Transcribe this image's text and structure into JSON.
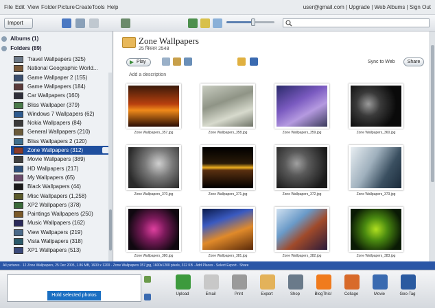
{
  "menu": [
    "File",
    "Edit",
    "View",
    "Folder",
    "Picture",
    "Create",
    "Tools",
    "Help"
  ],
  "account": "user@gmail.com | Upgrade | Web Albums | Sign Out",
  "toolbar": {
    "import_label": "Import"
  },
  "search": {
    "placeholder": ""
  },
  "zoom_slider": {
    "level": 0.55
  },
  "sidebar": {
    "albums": "Albums (1)",
    "folders": "Folders (89)",
    "items": [
      {
        "label": "Travel Wallpapers (325)",
        "color": "#6d7a89"
      },
      {
        "label": "National Geographic World...",
        "color": "#7a5a3a"
      },
      {
        "label": "Game Wallpaper 2 (155)",
        "color": "#3b4f6e"
      },
      {
        "label": "Game Wallpapers (184)",
        "color": "#5a3a3a"
      },
      {
        "label": "Car Wallpapers (160)",
        "color": "#2f2f3a"
      },
      {
        "label": "Bliss Wallpaper (379)",
        "color": "#4a7a4a"
      },
      {
        "label": "Windows 7 Wallpapers (62)",
        "color": "#2e5b8f"
      },
      {
        "label": "Nokia Wallpapers (84)",
        "color": "#3a3a3a"
      },
      {
        "label": "General Wallpapers (210)",
        "color": "#6b5b3a"
      },
      {
        "label": "Bliss Wallpapers 2 (120)",
        "color": "#3f6f8f"
      },
      {
        "label": "Zone Wallpapers (312)",
        "color": "#8a3a2a",
        "selected": true
      },
      {
        "label": "Movie Wallpapers (389)",
        "color": "#404040"
      },
      {
        "label": "HD Wallpapers (217)",
        "color": "#2d4f7a"
      },
      {
        "label": "My Wallpapers (65)",
        "color": "#6a4a6a"
      },
      {
        "label": "Black Wallpapers (44)",
        "color": "#1a1a1a"
      },
      {
        "label": "Misc Wallpapers (1,258)",
        "color": "#5a5a2a"
      },
      {
        "label": "XP2 Wallpapers (378)",
        "color": "#3a6a3a"
      },
      {
        "label": "Paintings Wallpapers (250)",
        "color": "#7a5a2a"
      },
      {
        "label": "Music Wallpapers (162)",
        "color": "#2a2a5a"
      },
      {
        "label": "View Wallpapers (219)",
        "color": "#4a6a8a"
      },
      {
        "label": "Vista Wallpapers (318)",
        "color": "#2a5a6a"
      },
      {
        "label": "XP1 Wallpapers (513)",
        "color": "#3a4a7a"
      }
    ]
  },
  "main": {
    "title": "Zone Wallpapers",
    "date": "25 विस्तार 2548",
    "play_label": "Play",
    "share_label": "Share",
    "sync_label": "Sync to Web",
    "add_description": "Add a description",
    "thumbs": [
      {
        "caption": "Zone Wallpapers_357.jpg",
        "bg": "linear-gradient(180deg,#3a1a0a 0%,#b8400e 45%,#f08a1a 60%,#2a0c04 100%)"
      },
      {
        "caption": "Zone Wallpapers_358.jpg",
        "bg": "linear-gradient(160deg,#c8ccc0 0%,#8f9486 40%,#d7dacd 70%,#6f7468 100%)"
      },
      {
        "caption": "Zone Wallpapers_359.jpg",
        "bg": "linear-gradient(150deg,#2a2a6a 0%,#7a5ac0 40%,#b59ae0 65%,#3a3a5a 100%)"
      },
      {
        "caption": "Zone Wallpapers_360.jpg",
        "bg": "radial-gradient(circle at 35% 45%,#9a9a9a 0%,#3a3a3a 30%,#0a0a0a 70%)"
      },
      {
        "caption": "Zone Wallpapers_370.jpg",
        "bg": "radial-gradient(circle at 60% 40%,#d0d0d0 0%,#7a7a7a 35%,#2a2a2a 80%)"
      },
      {
        "caption": "Zone Wallpapers_371.jpg",
        "bg": "linear-gradient(180deg,#000 0%,#2a1a08 40%,#f0b020 50%,#5a3010 56%,#000 100%)"
      },
      {
        "caption": "Zone Wallpapers_372.jpg",
        "bg": "radial-gradient(circle at 40% 40%,#a0a0a0 0%,#5a5a5a 30%,#1a1a1a 80%)"
      },
      {
        "caption": "Zone Wallpapers_373.jpg",
        "bg": "linear-gradient(120deg,#e8eef2 0%,#9fb0bd 40%,#3a4f60 70%,#1a2a3a 100%)"
      },
      {
        "caption": "Zone Wallpapers_380.jpg",
        "bg": "radial-gradient(circle at 50% 50%,#e040a0 0%,#7a1a5a 35%,#100810 80%)"
      },
      {
        "caption": "Zone Wallpapers_381.jpg",
        "bg": "linear-gradient(160deg,#0a1a4a 0%,#3a5ac0 30%,#e08a2a 60%,#5a2a0a 100%)"
      },
      {
        "caption": "Zone Wallpapers_382.jpg",
        "bg": "linear-gradient(140deg,#cfe0f0 0%,#6a9ac8 35%,#a04a2a 60%,#2a1a3a 100%)"
      },
      {
        "caption": "Zone Wallpapers_383.jpg",
        "bg": "radial-gradient(circle at 50% 50%,#b0e020 0%,#4a8a10 35%,#0a1a05 80%)"
      }
    ]
  },
  "status": "All pictures · 12 Zone Wallpapers, 25 Dec 2005, 1.86 MB, 1600 x 1200 · Zone Wallpapers 357.jpg, 1600x1200 pixels, 312 KB · Add Places · Select Export · Share",
  "tray": {
    "selection_label": "Hold selected photos",
    "items": [
      {
        "label": "Upload",
        "color": "#3d9a3d"
      },
      {
        "label": "Email",
        "color": "#c8c8c8"
      },
      {
        "label": "Print",
        "color": "#9a9a9a"
      },
      {
        "label": "Export",
        "color": "#e3b25a"
      },
      {
        "label": "Shop",
        "color": "#6a7a8a"
      },
      {
        "label": "BlogThis!",
        "color": "#f07b1d"
      },
      {
        "label": "Collage",
        "color": "#d86a2a"
      },
      {
        "label": "Movie",
        "color": "#3a6ab0"
      },
      {
        "label": "Geo-Tag",
        "color": "#2a5aa0"
      }
    ]
  }
}
